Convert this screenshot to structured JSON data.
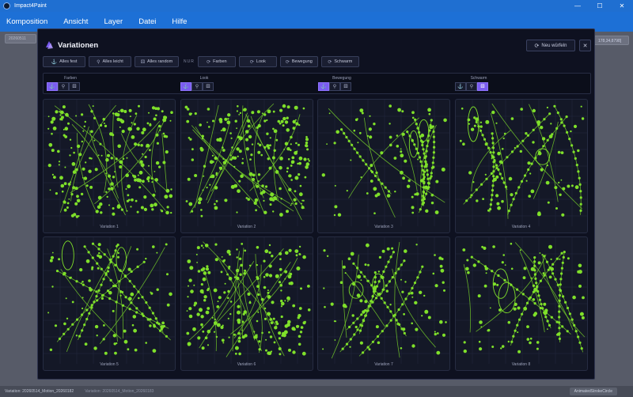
{
  "window": {
    "title": "Impact4Paint",
    "controls": {
      "minimize": "—",
      "maximize": "☐",
      "close": "✕"
    }
  },
  "menu": [
    "Komposition",
    "Ansicht",
    "Layer",
    "Datei",
    "Hilfe"
  ],
  "background": {
    "chip_left": "20260511",
    "chip_right": "178,34,8798]",
    "status_1": "Variation: 20260514_Motion_20260182",
    "status_2": "Variation: 20260514_Motion_20260183",
    "status_right": "AnimatedStrokeCircle"
  },
  "modal": {
    "title": "Variationen",
    "reroll_label": "Neu würfeln",
    "close_icon": "✕",
    "toolbar": {
      "fix_all": "Alles fest",
      "loosen_all": "Alles leicht",
      "randomize_all": "Alles random",
      "only_label": "NUR",
      "colors": "Farben",
      "look": "Look",
      "movement": "Bewegung",
      "swarm": "Schwarm"
    },
    "groups": [
      {
        "label": "Farben",
        "active": 0
      },
      {
        "label": "Look",
        "active": 0
      },
      {
        "label": "Bewegung",
        "active": 0
      },
      {
        "label": "Schwarm",
        "active": 2
      }
    ],
    "variations": [
      {
        "label": "Variation 1"
      },
      {
        "label": "Variation 2"
      },
      {
        "label": "Variation 3"
      },
      {
        "label": "Variation 4"
      },
      {
        "label": "Variation 5"
      },
      {
        "label": "Variation 6"
      },
      {
        "label": "Variation 7"
      },
      {
        "label": "Variation 8"
      }
    ]
  },
  "colors": {
    "accent": "#7a5cf0",
    "stroke": "#7fe02a",
    "titlebar": "#1f6fd1"
  },
  "icons": {
    "fix": "anchor-icon",
    "loose": "feather-icon",
    "random": "dice-icon",
    "reroll": "refresh-icon"
  }
}
